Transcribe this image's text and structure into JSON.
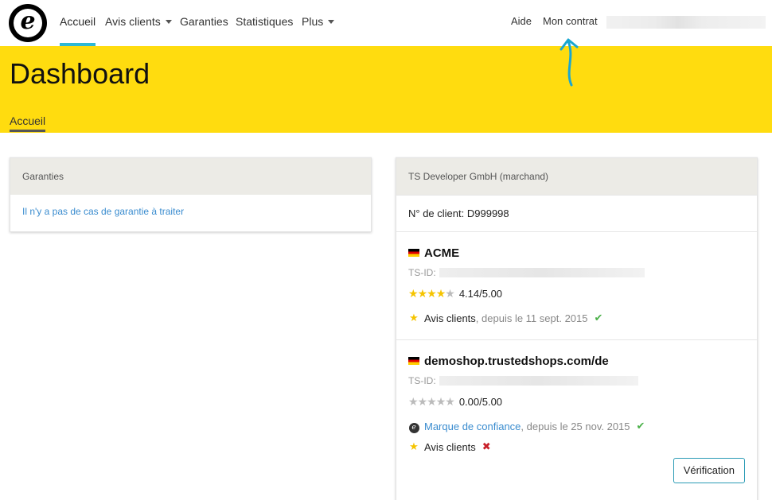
{
  "nav": {
    "logo_letter": "e",
    "items": [
      {
        "label": "Accueil",
        "active": true
      },
      {
        "label": "Avis clients",
        "dropdown": true
      },
      {
        "label": "Garanties"
      },
      {
        "label": "Statistiques"
      },
      {
        "label": "Plus",
        "dropdown": true
      }
    ],
    "right": {
      "help": "Aide",
      "contract": "Mon contrat"
    }
  },
  "header": {
    "title": "Dashboard",
    "breadcrumb": "Accueil",
    "background": "#ffdc0f"
  },
  "guarantees_card": {
    "title": "Garanties",
    "message": "Il n'y a pas de cas de garantie à traiter"
  },
  "merchant_card": {
    "title": "TS Developer GmbH (marchand)",
    "client_no_label": "N° de client:",
    "client_no": "D999998",
    "shops": [
      {
        "name": "ACME",
        "flag": "de",
        "tsid_label": "TS-ID:",
        "stars_filled": 4.14,
        "rating": "4.14/5.00",
        "features": [
          {
            "icon": "star-icon",
            "label": "Avis clients",
            "since": ", depuis le 11 sept. 2015",
            "status": "check"
          }
        ]
      },
      {
        "name": "demoshop.trustedshops.com/de",
        "flag": "de",
        "tsid_label": "TS-ID:",
        "stars_filled": 0,
        "rating": "0.00/5.00",
        "features": [
          {
            "icon": "trustmark-icon",
            "label": "Marque de confiance",
            "since": ", depuis le 25 nov. 2015",
            "status": "check",
            "link": true
          },
          {
            "icon": "star-icon",
            "label": "Avis clients",
            "since": "",
            "status": "cross"
          }
        ],
        "button": "Vérification"
      }
    ]
  },
  "colors": {
    "accent": "#2db8d6",
    "link": "#3a8ccf",
    "check": "#4cb14a",
    "cross": "#c8202a"
  }
}
